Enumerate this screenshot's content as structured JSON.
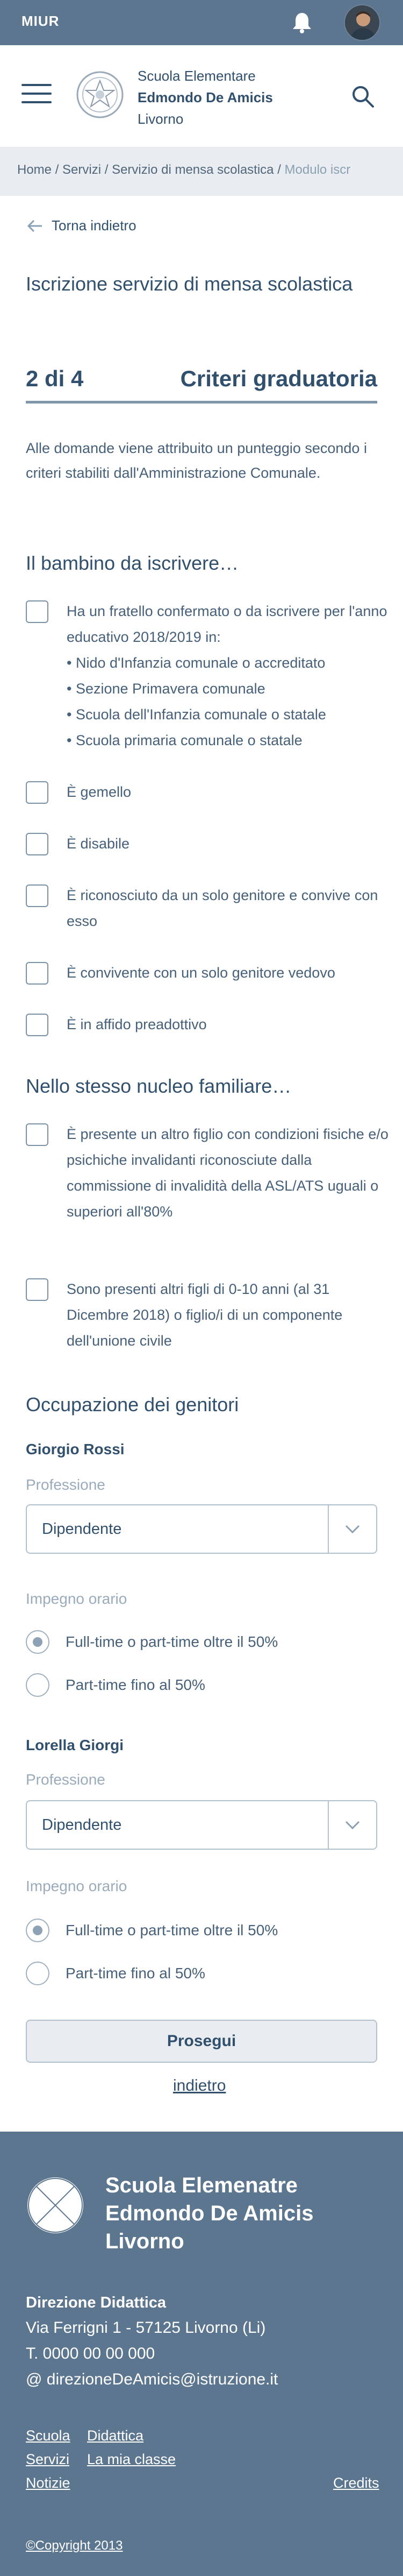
{
  "topbar": {
    "brand": "MIUR",
    "bell_icon": "bell-icon",
    "avatar": "user-avatar"
  },
  "header": {
    "org_line1": "Scuola Elementare",
    "org_line2": "Edmondo De Amicis",
    "org_line3": "Livorno",
    "menu_icon": "hamburger-icon",
    "search_icon": "search-icon"
  },
  "breadcrumb": {
    "home": "Home",
    "servizi": "Servizi",
    "mensa": "Servizio di mensa scolastica",
    "modulo": "Modulo iscr"
  },
  "back_label": "Torna indietro",
  "title": "Iscrizione servizio di mensa scolastica",
  "step": {
    "number": "2 di 4",
    "label": "Criteri graduatoria"
  },
  "intro": "Alle domande viene attribuito un punteggio secondo i criteri stabiliti dall'Amministrazione Comunale.",
  "section1": {
    "heading": "Il bambino da iscrivere…",
    "items": [
      "Ha un fratello confermato o da iscrivere per l'anno educativo 2018/2019 in:",
      "È gemello",
      "È disabile",
      "È riconosciuto da un solo genitore e convive con esso",
      "È convivente con un solo genitore vedovo",
      "È in affido preadottivo"
    ],
    "sub_items": [
      "Nido d'Infanzia comunale o accreditato",
      "Sezione Primavera comunale",
      "Scuola dell'Infanzia comunale o statale",
      "Scuola primaria comunale o statale"
    ]
  },
  "section2": {
    "heading": "Nello stesso nucleo familiare…",
    "items": [
      "È presente un altro figlio con condizioni fisiche e/o psichiche invalidanti riconosciute dalla commissione di invalidità della ASL/ATS uguali o superiori all'80%",
      "Sono presenti altri figli di 0-10 anni (al 31 Dicembre 2018) o figlio/i di un componente dell'unione civile"
    ]
  },
  "section3": {
    "heading": "Occupazione dei genitori",
    "professione_label": "Professione",
    "impegno_label": "Impegno orario",
    "option_full": "Full-time o part-time oltre il 50%",
    "option_part": "Part-time fino al 50%",
    "parents": [
      {
        "name": "Giorgio Rossi",
        "professione": "Dipendente",
        "selected": "full"
      },
      {
        "name": "Lorella Giorgi",
        "professione": "Dipendente",
        "selected": "full"
      }
    ]
  },
  "actions": {
    "submit": "Prosegui",
    "back": "indietro"
  },
  "footer": {
    "school_line1": "Scuola Elemenatre",
    "school_line2": "Edmondo De Amicis",
    "school_line3": "Livorno",
    "direzione": "Direzione Didattica",
    "address": "Via Ferrigni 1 - 57125 Livorno (Li)",
    "phone": "T. 0000 00 00 000",
    "email": "@ direzioneDeAmicis@istruzione.it",
    "links": [
      "Scuola",
      "Didattica",
      "Servizi",
      "La mia classe",
      "Notizie",
      "Credits"
    ],
    "copyright": "©Copyright 2013"
  },
  "colors": {
    "primary": "#5c7690",
    "text": "#31506d",
    "breadcrumb_bg": "#e9edf1"
  }
}
